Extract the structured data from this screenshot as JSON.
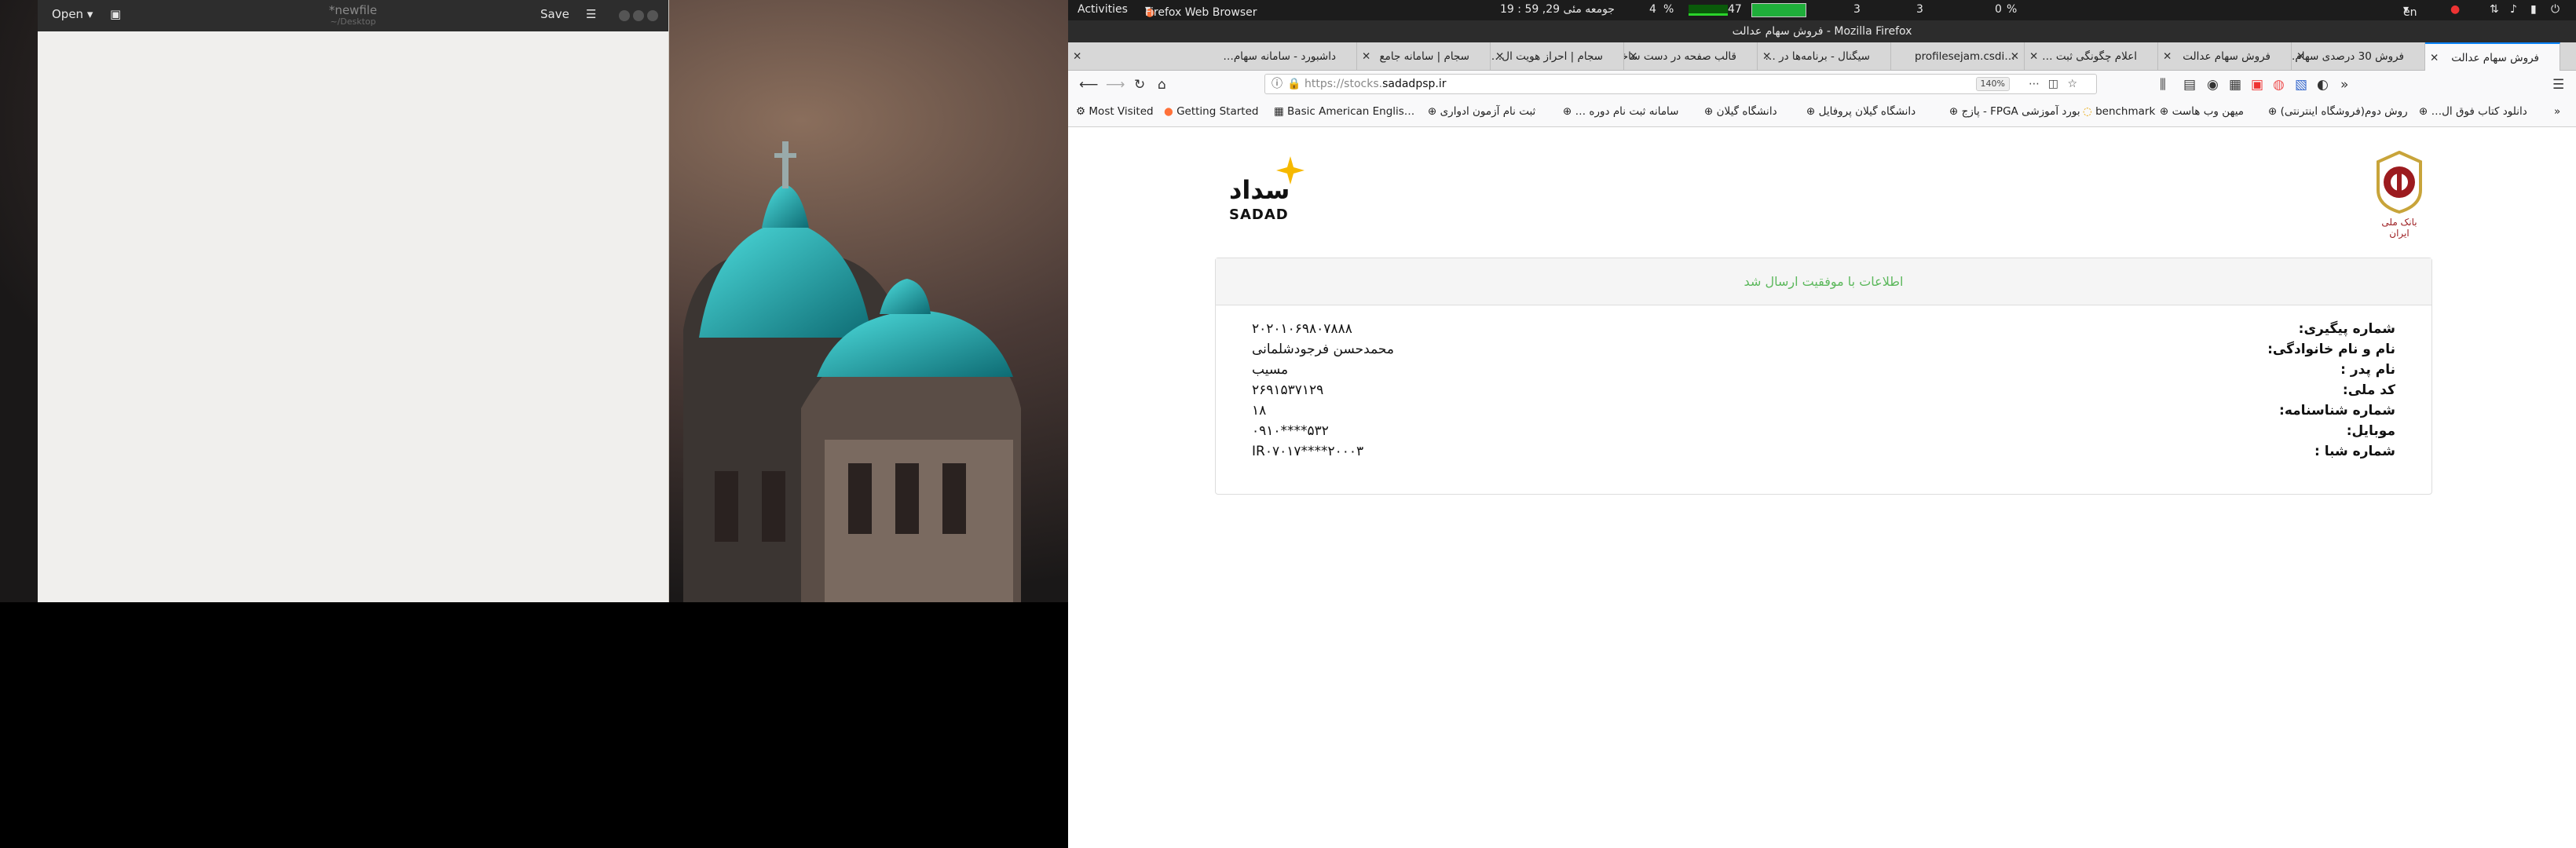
{
  "gedit": {
    "open_label": "Open",
    "title": "*newfile",
    "subtitle": "~/Desktop",
    "save_label": "Save"
  },
  "topbar": {
    "activities": "Activities",
    "app_menu": "Firefox Web Browser",
    "datetime": "جومعه مئی 29, 59 : 19",
    "cpu_pct": "4",
    "temp": "47",
    "num_a": "3",
    "num_b": "3",
    "net_pct": "0",
    "lang": "en"
  },
  "window_title": "فروش سهام عدالت - Mozilla Firefox",
  "tabs": [
    {
      "label": "فروش سهام عدالت",
      "active": true
    },
    {
      "label": "فروش 30 درصدی سهام…",
      "active": false
    },
    {
      "label": "فروش سهام عدالت",
      "active": false
    },
    {
      "label": "اعلام چگونگی ثبت …",
      "active": false
    },
    {
      "label": "profilesejam.csdi…",
      "active": false
    },
    {
      "label": "سیگنال - برنامه‌ها در …",
      "active": false
    },
    {
      "label": "قالب صفحه در دست ساخت",
      "active": false
    },
    {
      "label": "سجام | احراز هویت ال…",
      "active": false
    },
    {
      "label": "سجام | سامانه جامع",
      "active": false
    },
    {
      "label": "داشبورد - سامانه سهام…",
      "active": false
    }
  ],
  "url": {
    "prefix": "https://stocks.",
    "domain": "sadadpsp.ir",
    "zoom": "140%"
  },
  "bookmarks": [
    "Most Visited",
    "Getting Started",
    "Basic American Englis…",
    "ثبت نام آزمون ادواری",
    "سامانه ثبت نام دوره …",
    "دانشگاه گیلان",
    "دانشگاه گیلان پروفایل",
    "بورد آموزشی FPGA - پازج",
    "benchmark",
    "میهن وب هاست",
    "روش دوم(فروشگاه اینترنتی)",
    "دانلود کتاب فوق ال…"
  ],
  "page": {
    "sadad_logo_text": "SADAD",
    "sadad_logo_fa": "سداد",
    "bank_name_fa": "بانک ملی ایران",
    "success_message": "اطلاعات با موفقیت ارسال شد",
    "fields": [
      {
        "label": "شماره پیگیری:",
        "value": "۲۰۲۰۱۰۶۹۸۰۷۸۸۸"
      },
      {
        "label": "نام و نام خانوادگی:",
        "value": "محمدحسن فرجودشلمانی"
      },
      {
        "label": "نام پدر :",
        "value": "مسیب"
      },
      {
        "label": "کد ملی:",
        "value": "۲۶۹۱۵۳۷۱۲۹"
      },
      {
        "label": "شماره شناسنامه:",
        "value": "۱۸"
      },
      {
        "label": "موبایل:",
        "value": "۰۹۱۰****۵۳۲"
      },
      {
        "label": "شماره شبا :",
        "value": "IR۰۷۰۱۷****۲۰۰۰۳"
      }
    ]
  },
  "colors": {
    "success_green": "#5cb85c",
    "sadad_yellow": "#f6b900",
    "bmi_red": "#9c1b1f",
    "tab_accent": "#0a84ff"
  }
}
